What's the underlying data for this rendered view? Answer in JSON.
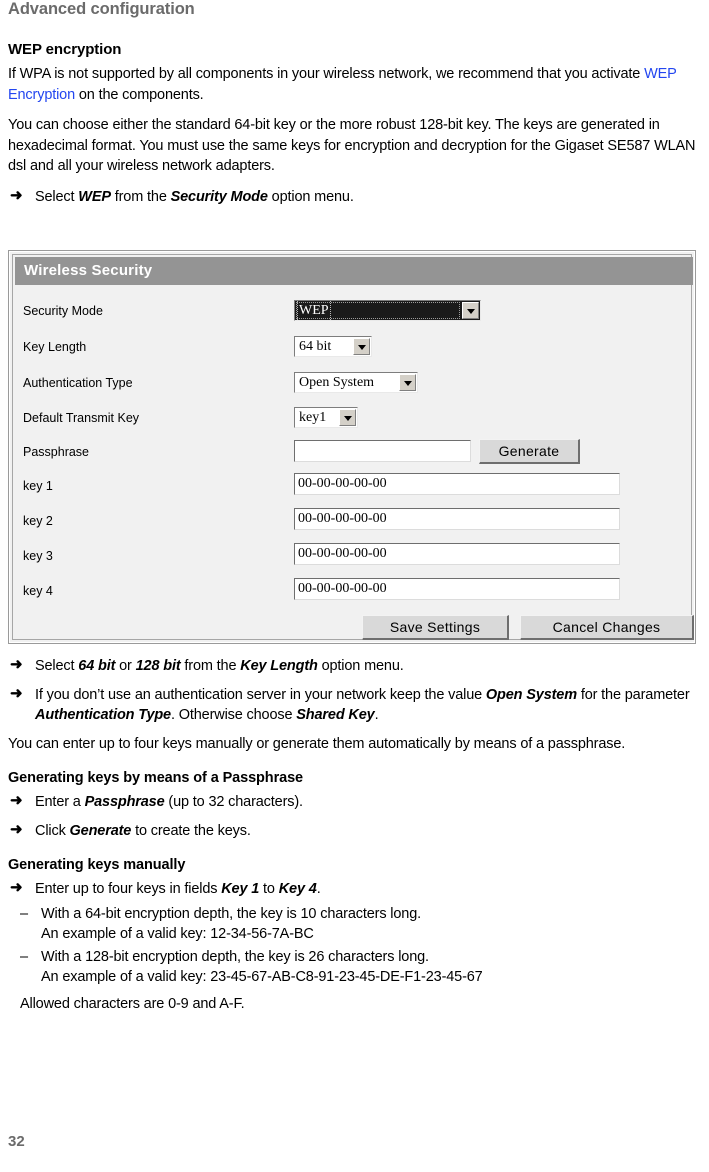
{
  "page": {
    "running_head": "Advanced configuration",
    "folio": "32",
    "link_color": "#2346f0",
    "head_color": "#6b6b6b"
  },
  "section": {
    "heading": "WEP encryption",
    "intro_before_link": "If WPA is not supported by all components in your wireless network, we recommend that you activate ",
    "intro_link": "WEP Encryption",
    "intro_after_link": " on the components.",
    "para2": "You can choose either the standard 64-bit key or the more robust 128-bit key. The keys are generated in hexadecimal format. You must use the same keys for encryption and decryption for the Gigaset SE587 WLAN dsl and all your wireless network adapters.",
    "step1_pre": "Select ",
    "step1_b1": "WEP",
    "step1_mid": " from the ",
    "step1_b2": "Security Mode",
    "step1_post": " option menu."
  },
  "screenshot": {
    "title": "Wireless Security",
    "rows": [
      {
        "label": "Security Mode",
        "value": "WEP",
        "control": "select",
        "focused": true
      },
      {
        "label": "Key Length",
        "value": "64 bit",
        "control": "select",
        "focused": false
      },
      {
        "label": "Authentication Type",
        "value": "Open System",
        "control": "select",
        "focused": false
      },
      {
        "label": "Default Transmit Key",
        "value": "key1",
        "control": "select",
        "focused": false
      },
      {
        "label": "Passphrase",
        "value": "",
        "control": "text",
        "focused": false
      },
      {
        "label": "key 1",
        "value": "00-00-00-00-00",
        "control": "text",
        "focused": false
      },
      {
        "label": "key 2",
        "value": "00-00-00-00-00",
        "control": "text",
        "focused": false
      },
      {
        "label": "key 3",
        "value": "00-00-00-00-00",
        "control": "text",
        "focused": false
      },
      {
        "label": "key 4",
        "value": "00-00-00-00-00",
        "control": "text",
        "focused": false
      }
    ],
    "generate_label": "Generate",
    "save_label": "Save Settings",
    "cancel_label": "Cancel Changes",
    "header_bg": "#949494",
    "panel_bg": "#f1f1f1"
  },
  "steps": {
    "key_length": {
      "pre": "Select ",
      "b1": "64 bit",
      "mid": " or ",
      "b2": "128 bit",
      "mid2": " from the ",
      "b3": "Key Length",
      "post": " option menu."
    },
    "auth": {
      "pre": "If you don’t use an authentication server in your network keep the value ",
      "b1": "Open System",
      "mid": " for the parameter ",
      "b2": "Authentication Type",
      "mid2": ". Otherwise choose ",
      "b3": "Shared Key",
      "post": "."
    },
    "note": "You can enter up to four keys manually or generate them automatically by means of a passphrase."
  },
  "passphrase_section": {
    "heading": "Generating keys by means of a Passphrase",
    "step1_pre": "Enter a ",
    "step1_b": "Passphrase",
    "step1_post": " (up to 32 characters).",
    "step2_pre": "Click ",
    "step2_b": "Generate",
    "step2_post": " to create the keys."
  },
  "manual_section": {
    "heading": "Generating keys manually",
    "step1_pre": "Enter up to four keys in fields ",
    "step1_b1": "Key 1",
    "step1_mid": " to ",
    "step1_b2": "Key 4",
    "step1_post": ".",
    "bullets": [
      {
        "line1": "With a 64-bit encryption depth, the key is 10 characters long.",
        "line2": "An example of a valid key: 12-34-56-7A-BC"
      },
      {
        "line1": "With a 128-bit encryption depth, the key is 26 characters long.",
        "line2": "An example of a valid key: 23-45-67-AB-C8-91-23-45-DE-F1-23-45-67"
      }
    ],
    "allowed": "Allowed characters are 0-9 and A-F."
  },
  "icons": {
    "arrow": "➜",
    "dash": "–",
    "chevron_down": "chevron-down-icon"
  }
}
